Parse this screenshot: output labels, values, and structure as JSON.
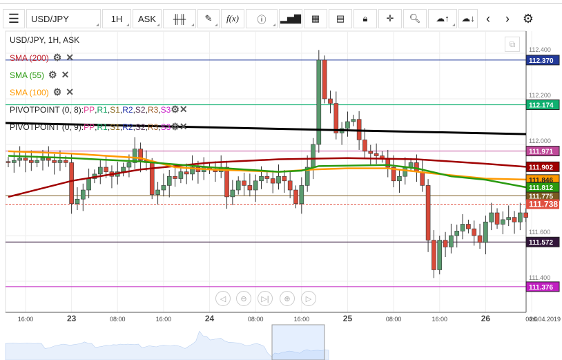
{
  "toolbar": {
    "symbol": "USD/JPY",
    "timeframe": "1H",
    "price_type": "ASK"
  },
  "chart": {
    "title": "USD/JPY, 1H, ASK",
    "indicators": [
      {
        "label": "SMA (200)",
        "color": "#c0202a"
      },
      {
        "label": "SMA (55)",
        "color": "#2a9a10"
      },
      {
        "label": "SMA (100)",
        "color": "#ff9900"
      }
    ],
    "pivots": [
      {
        "label": "PIVOTPOINT (0, 8)",
        "sep": " : "
      },
      {
        "label": "PIVOTPOINT (0, 9)",
        "sep": " : "
      }
    ],
    "pivot_parts": [
      {
        "t": "PP",
        "c": "#e0358f"
      },
      {
        "t": "R1",
        "c": "#10a060"
      },
      {
        "t": "S1",
        "c": "#8a6a20"
      },
      {
        "t": "R2",
        "c": "#2233aa"
      },
      {
        "t": "S2",
        "c": "#553355"
      },
      {
        "t": "R3",
        "c": "#a0602a"
      },
      {
        "t": "S3",
        "c": "#cc22cc"
      }
    ],
    "price_ticks": [
      "112.400",
      "112.200",
      "112.000",
      "111.600",
      "111.400"
    ],
    "price_tick_values": [
      112.4,
      112.2,
      112.0,
      111.6,
      111.4
    ],
    "levels": [
      {
        "value": 112.37,
        "text": "112.370",
        "color": "#233a9a",
        "fg": "#fff"
      },
      {
        "value": 112.174,
        "text": "112.174",
        "color": "#10b070",
        "fg": "#fff"
      },
      {
        "value": 111.971,
        "text": "111.971",
        "color": "#c04a9a",
        "fg": "#fff"
      },
      {
        "value": 111.775,
        "text": "111.775",
        "color": "#7a5a20",
        "fg": "#fff"
      },
      {
        "value": 111.572,
        "text": "111.572",
        "color": "#32163a",
        "fg": "#fff"
      },
      {
        "value": 111.376,
        "text": "111.376",
        "color": "#c020c0",
        "fg": "#fff"
      }
    ],
    "sma_labels": [
      {
        "value": 111.902,
        "text": "111.902",
        "color": "#a00000",
        "fg": "#fff"
      },
      {
        "value": 111.846,
        "text": "111.846",
        "color": "#ff9900",
        "fg": "#222"
      },
      {
        "value": 111.812,
        "text": "111.812",
        "color": "#2a9a10",
        "fg": "#fff"
      }
    ],
    "current_price": {
      "value": 111.738,
      "text": "111.738",
      "color": "#e05040"
    },
    "trendline": [
      112.094,
      112.045
    ],
    "time_labels": [
      {
        "t": "16:00",
        "i": 3
      },
      {
        "t": "23",
        "i": 11,
        "bold": true
      },
      {
        "t": "08:00",
        "i": 19
      },
      {
        "t": "16:00",
        "i": 27
      },
      {
        "t": "24",
        "i": 35,
        "bold": true
      },
      {
        "t": "08:00",
        "i": 43
      },
      {
        "t": "16:00",
        "i": 51
      },
      {
        "t": "25",
        "i": 59,
        "bold": true
      },
      {
        "t": "08:00",
        "i": 67
      },
      {
        "t": "16:00",
        "i": 75
      },
      {
        "t": "26",
        "i": 83,
        "bold": true
      },
      {
        "t": "08:0",
        "i": 91
      }
    ],
    "date_label": "26.04.2019",
    "closes": [
      111.92,
      111.93,
      111.94,
      111.93,
      111.92,
      111.93,
      111.94,
      111.93,
      111.92,
      111.93,
      111.92,
      111.74,
      111.76,
      111.8,
      111.85,
      111.87,
      111.9,
      111.88,
      111.86,
      111.88,
      111.9,
      111.92,
      111.98,
      111.93,
      111.92,
      111.78,
      111.8,
      111.82,
      111.86,
      111.85,
      111.88,
      111.87,
      111.9,
      111.88,
      111.9,
      111.89,
      111.88,
      111.9,
      111.77,
      111.8,
      111.84,
      111.82,
      111.8,
      111.84,
      111.86,
      111.85,
      111.83,
      111.86,
      111.84,
      111.8,
      111.74,
      111.82,
      111.9,
      112.0,
      112.37,
      112.2,
      112.18,
      112.05,
      112.07,
      112.1,
      112.11,
      112.02,
      111.97,
      111.96,
      111.95,
      111.94,
      111.9,
      111.84,
      111.86,
      111.9,
      111.92,
      111.88,
      111.82,
      111.58,
      111.45,
      111.58,
      111.55,
      111.6,
      111.62,
      111.65,
      111.63,
      111.6,
      111.57,
      111.66,
      111.7,
      111.65,
      111.67,
      111.68,
      111.66,
      111.7,
      111.68
    ],
    "sma200": [
      [
        0,
        111.77
      ],
      [
        11,
        111.84
      ],
      [
        23,
        111.89
      ],
      [
        35,
        111.92
      ],
      [
        47,
        111.935
      ],
      [
        59,
        111.94
      ],
      [
        71,
        111.935
      ],
      [
        83,
        111.915
      ],
      [
        90,
        111.902
      ]
    ],
    "sma100": [
      [
        0,
        111.97
      ],
      [
        11,
        111.96
      ],
      [
        23,
        111.94
      ],
      [
        29,
        111.9
      ],
      [
        35,
        111.89
      ],
      [
        47,
        111.88
      ],
      [
        53,
        111.89
      ],
      [
        59,
        111.895
      ],
      [
        66,
        111.895
      ],
      [
        73,
        111.875
      ],
      [
        83,
        111.85
      ],
      [
        90,
        111.846
      ]
    ],
    "sma55": [
      [
        0,
        111.95
      ],
      [
        11,
        111.94
      ],
      [
        23,
        111.925
      ],
      [
        35,
        111.9
      ],
      [
        47,
        111.88
      ],
      [
        51,
        111.885
      ],
      [
        54,
        111.905
      ],
      [
        66,
        111.91
      ],
      [
        71,
        111.895
      ],
      [
        77,
        111.86
      ],
      [
        83,
        111.845
      ],
      [
        90,
        111.812
      ]
    ]
  }
}
